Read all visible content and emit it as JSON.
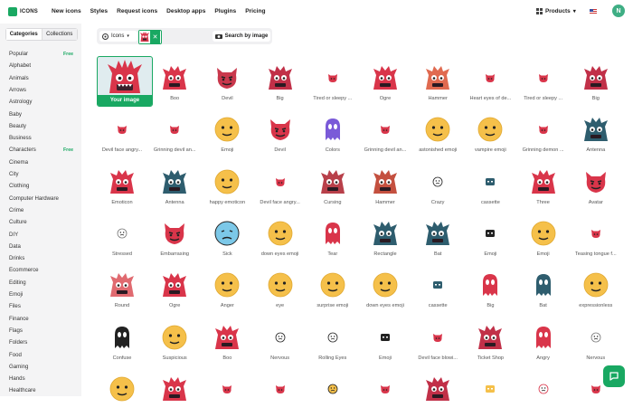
{
  "brand": {
    "name": "ICONS",
    "color": "#19a862"
  },
  "nav": [
    "New icons",
    "Styles",
    "Request icons",
    "Desktop apps",
    "Plugins",
    "Pricing"
  ],
  "header_right": {
    "products_label": "Products",
    "avatar_letter": "N"
  },
  "sidebar": {
    "tabs": [
      "Categories",
      "Collections"
    ],
    "items": [
      {
        "label": "Popular",
        "badge": "Free"
      },
      {
        "label": "Alphabet"
      },
      {
        "label": "Animals"
      },
      {
        "label": "Arrows"
      },
      {
        "label": "Astrology"
      },
      {
        "label": "Baby"
      },
      {
        "label": "Beauty"
      },
      {
        "label": "Business"
      },
      {
        "label": "Characters",
        "badge": "Free"
      },
      {
        "label": "Cinema"
      },
      {
        "label": "City"
      },
      {
        "label": "Clothing"
      },
      {
        "label": "Computer Hardware"
      },
      {
        "label": "Crime"
      },
      {
        "label": "Culture"
      },
      {
        "label": "DIY"
      },
      {
        "label": "Data"
      },
      {
        "label": "Drinks"
      },
      {
        "label": "Ecommerce"
      },
      {
        "label": "Editing"
      },
      {
        "label": "Emoji"
      },
      {
        "label": "Files"
      },
      {
        "label": "Finance"
      },
      {
        "label": "Flags"
      },
      {
        "label": "Folders"
      },
      {
        "label": "Food"
      },
      {
        "label": "Gaming"
      },
      {
        "label": "Hands"
      },
      {
        "label": "Healthcare"
      }
    ]
  },
  "search": {
    "dropdown_label": "Icons",
    "search_by_image": "Search by image"
  },
  "featured_label": "Your image",
  "grid": [
    [
      "",
      "Boo",
      "Devil",
      "Big",
      "Tired or sleepy ...",
      "Ogre",
      "Hammer",
      "Heart eyes of de...",
      "Tired or sleepy ...",
      "Big"
    ],
    [
      "Devil face angry...",
      "Grinning devil an...",
      "Emoji",
      "Devil",
      "Colors",
      "Grinning devil an...",
      "astonished emoji",
      "vampire emoji",
      "Grinning demon ...",
      "Antenna"
    ],
    [
      "Emoticon",
      "Antenna",
      "happy emoticon",
      "Devil face angry...",
      "Cursing",
      "Hammer",
      "Crazy",
      "cassette",
      "Three",
      "Avatar"
    ],
    [
      "Stressed",
      "Embarrasing",
      "Sick",
      "down eyes emoji",
      "Tear",
      "Rectangle",
      "Bat",
      "Emoji",
      "Emoji",
      "Teasing tongue f..."
    ],
    [
      "Round",
      "Ogre",
      "Anger",
      "eye",
      "surprise emoji",
      "down eyes emoji",
      "cassette",
      "Big",
      "Bat",
      "expressionless"
    ],
    [
      "Confuse",
      "Suspicious",
      "Boo",
      "Nervous",
      "Rolling Eyes",
      "Emoji",
      "Devil face blowi...",
      "Ticket Shop",
      "Angry",
      "Nervous"
    ],
    [
      "",
      "",
      "",
      "",
      "",
      "",
      "",
      "",
      "",
      ""
    ]
  ],
  "colors": {
    "red": "#d9354a",
    "yellow": "#f5c04a",
    "teal": "#2e5d6e",
    "purple": "#7a5ad8",
    "green": "#19a862"
  }
}
